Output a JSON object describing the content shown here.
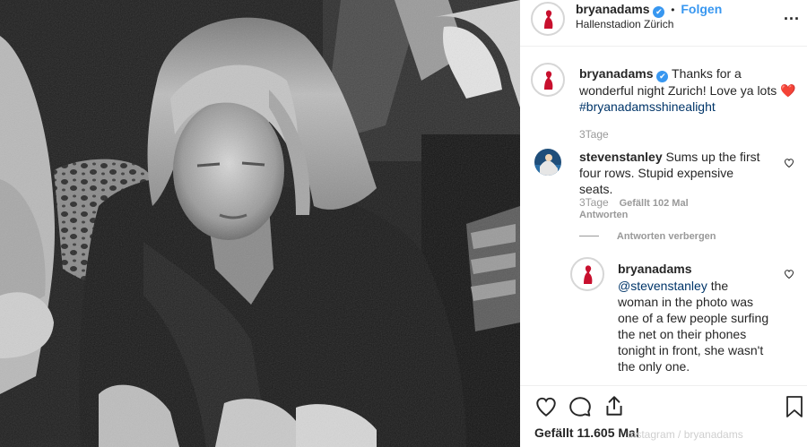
{
  "header": {
    "username": "bryanadams",
    "verified_mark": "✔",
    "separator": "•",
    "follow_label": "Folgen",
    "location": "Hallenstadion Zürich",
    "more_label": "..."
  },
  "caption": {
    "username": "bryanadams",
    "text": "Thanks for a wonderful night Zurich! Love ya lots",
    "emoji": "❤️",
    "hashtag": "#bryanadamsshinealight",
    "time": "3Tage"
  },
  "comments": [
    {
      "username": "stevenstanley",
      "text": "Sums up the first four rows. Stupid expensive seats.",
      "time": "3Tage",
      "likes": "Gefällt 102 Mal",
      "reply_label": "Antworten",
      "hide_replies_label": "Antworten verbergen"
    }
  ],
  "reply": {
    "username": "bryanadams",
    "mention": "@stevenstanley",
    "text": "the woman in the photo was one of a few people surfing the net on their phones tonight in front, she wasn't the only one."
  },
  "actions": {
    "likes": "Gefällt 11.605 Mal",
    "watermark": "instagram / bryanadams"
  },
  "icons": {
    "like": "heart-icon",
    "comment": "comment-icon",
    "share": "share-icon",
    "save": "bookmark-icon"
  },
  "colors": {
    "link_blue": "#3897f0",
    "hashtag": "#003569",
    "muted": "#999999",
    "avatar_red": "#c8102e"
  }
}
